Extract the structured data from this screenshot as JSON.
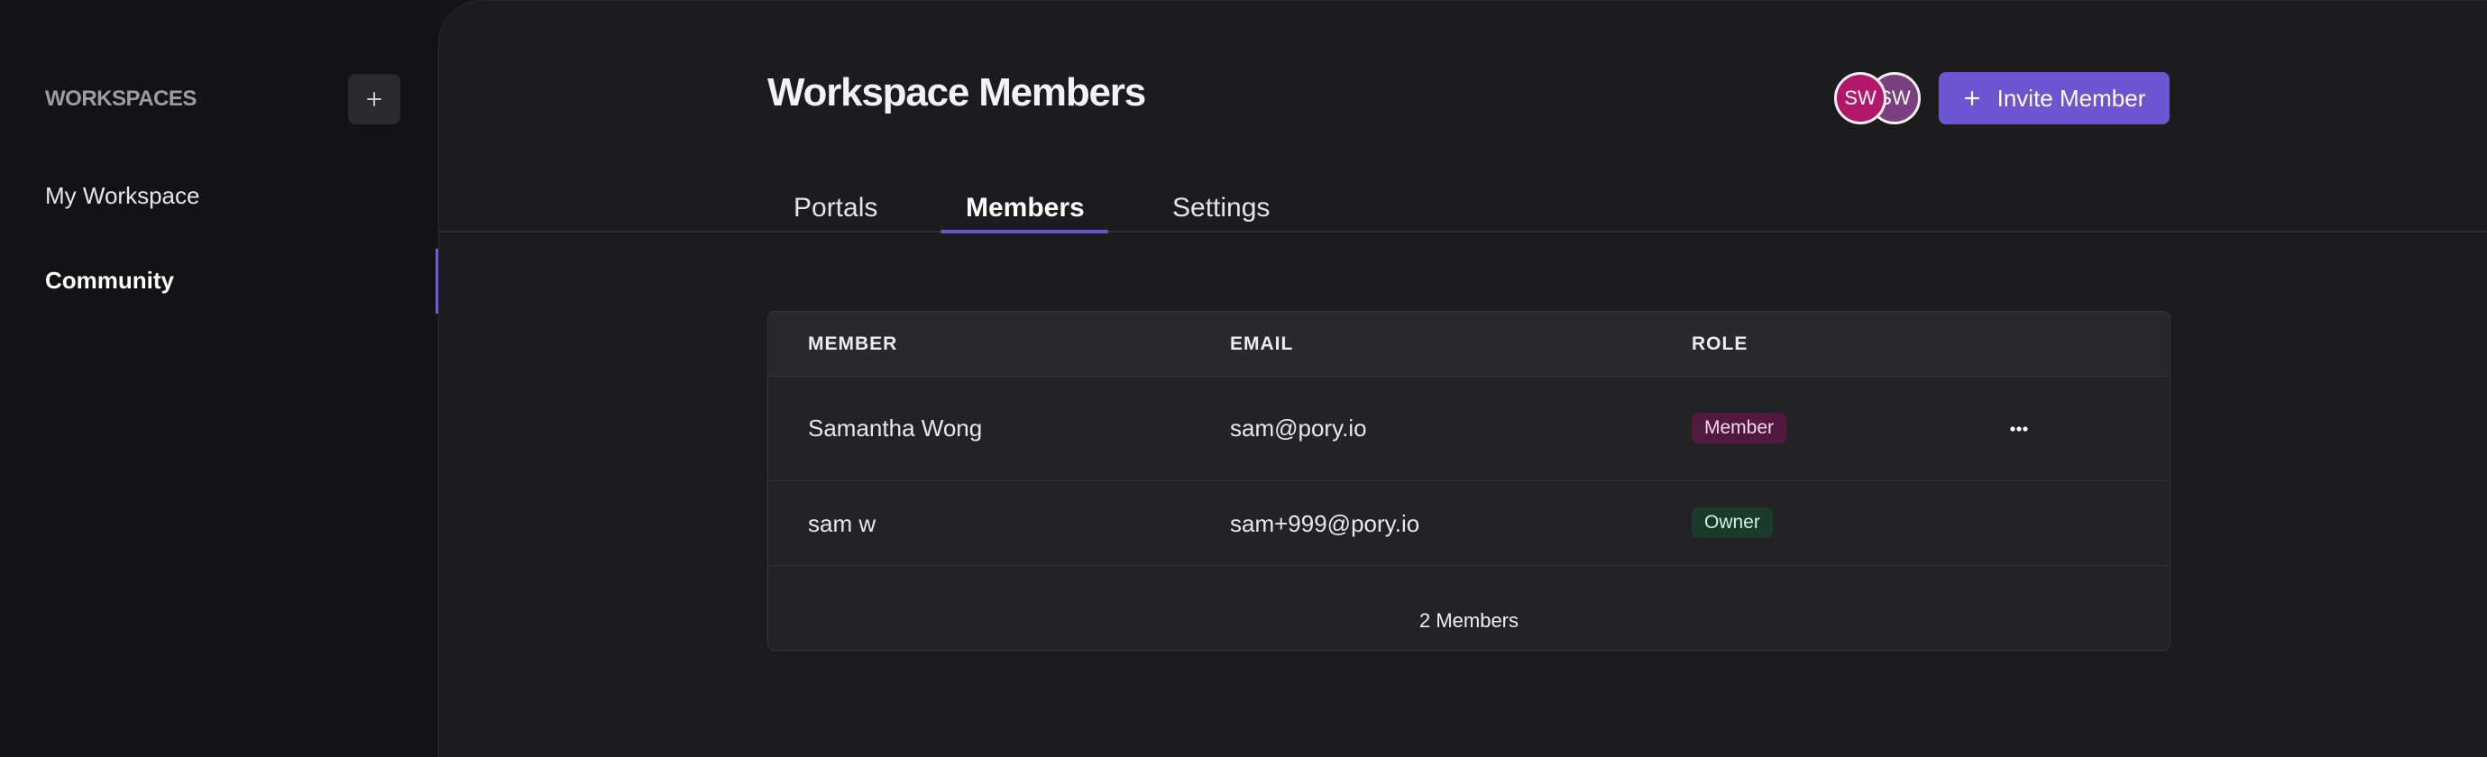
{
  "sidebar": {
    "title": "WORKSPACES",
    "add_icon": "plus-icon",
    "items": [
      {
        "label": "My Workspace",
        "active": false
      },
      {
        "label": "Community",
        "active": true
      }
    ]
  },
  "header": {
    "title": "Workspace Members",
    "avatars": [
      {
        "initials": "SW",
        "color": "#b3176a"
      },
      {
        "initials": "SW",
        "color": "#7a3f7f"
      }
    ],
    "invite_button": {
      "icon": "plus-icon",
      "label": "Invite Member"
    }
  },
  "tabs": [
    {
      "label": "Portals",
      "active": false
    },
    {
      "label": "Members",
      "active": true
    },
    {
      "label": "Settings",
      "active": false
    }
  ],
  "table": {
    "columns": [
      "MEMBER",
      "EMAIL",
      "ROLE"
    ],
    "rows": [
      {
        "name": "Samantha Wong",
        "email": "sam@pory.io",
        "role": "Member",
        "has_menu": true,
        "menu_icon": "more-horizontal-icon"
      },
      {
        "name": "sam w",
        "email": "sam+999@pory.io",
        "role": "Owner",
        "has_menu": false
      }
    ],
    "footer": "2 Members"
  },
  "colors": {
    "accent": "#6d55d1",
    "member_badge": "#51193f",
    "owner_badge": "#1a3a2c",
    "background": "#1c1c1f",
    "sidebar": "#131315"
  }
}
